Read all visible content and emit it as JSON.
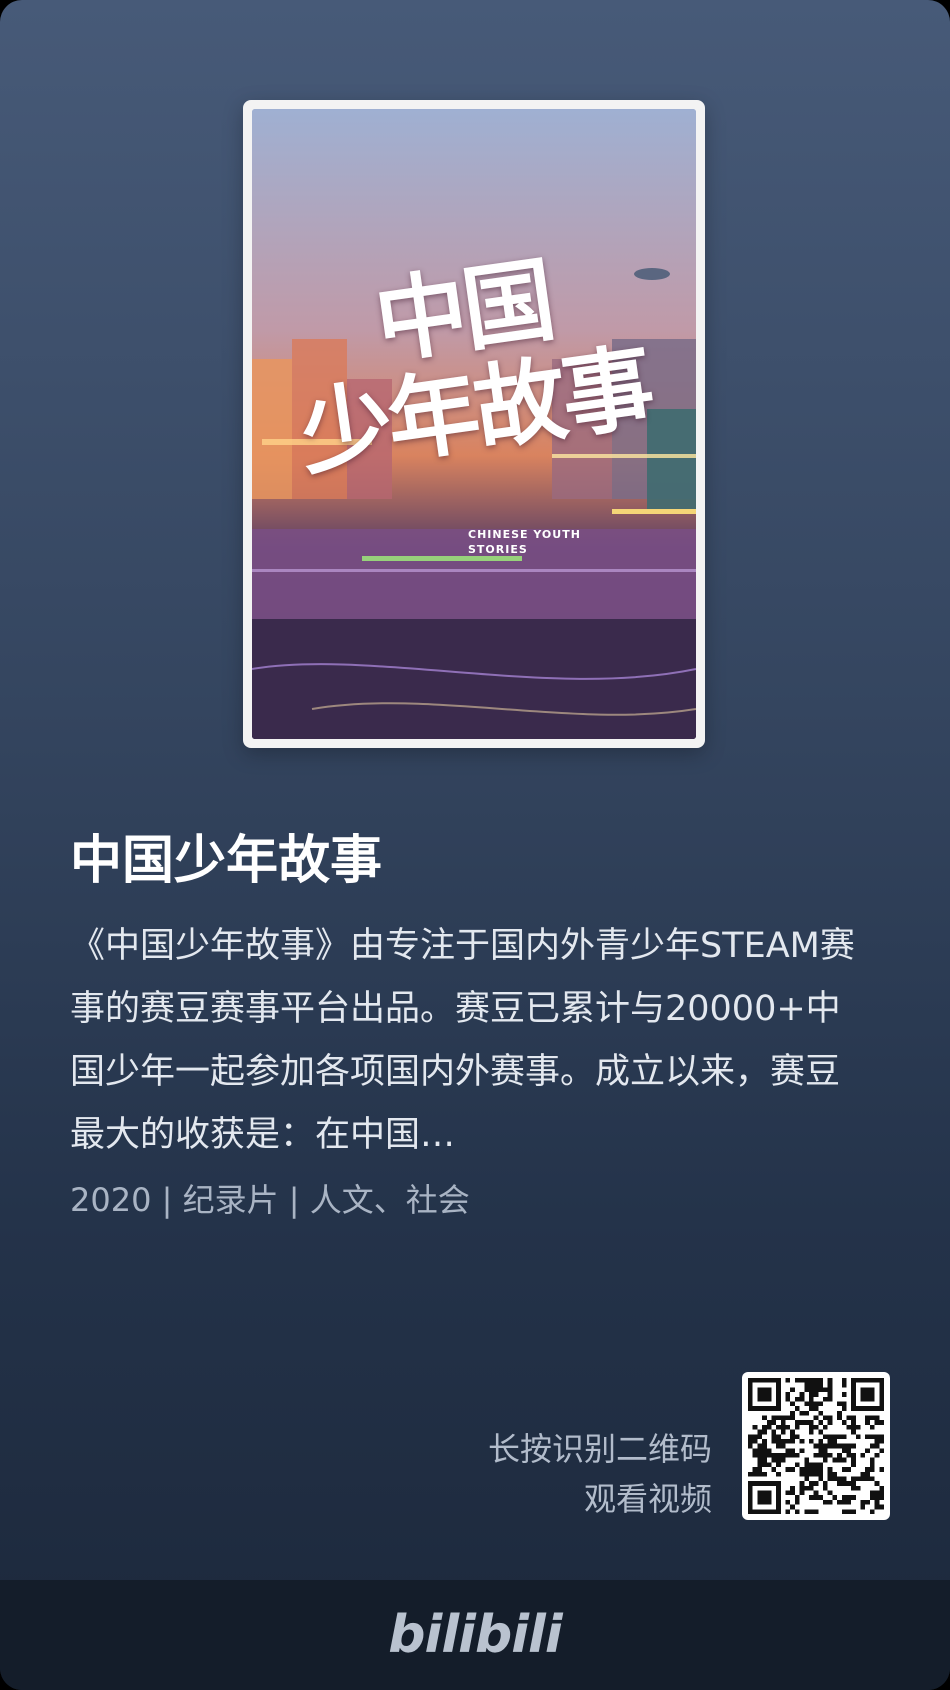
{
  "poster": {
    "title_cn_line1": "中国",
    "title_cn_line2": "少年故事",
    "title_en": "CHINESE YOUTH\nSTORIES"
  },
  "show": {
    "title": "中国少年故事",
    "description": "《中国少年故事》由专注于国内外青少年STEAM赛事的赛豆赛事平台出品。赛豆已累计与20000+中国少年一起参加各项国内外赛事。成立以来，赛豆最大的收获是：在中国…",
    "meta": "2020 | 纪录片 | 人文、社会"
  },
  "qr": {
    "hint_line1": "长按识别二维码",
    "hint_line2": "观看视频"
  },
  "footer": {
    "brand": "bilibili"
  },
  "colors": {
    "background_top": "#475a78",
    "background_bottom": "#1c283b",
    "footer": "#141d2a",
    "title_text": "#ffffff"
  }
}
